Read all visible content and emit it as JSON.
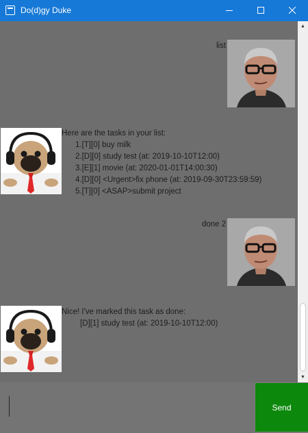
{
  "window": {
    "title": "Do(d)gy Duke",
    "controls": {
      "minimize": "minimize-icon",
      "maximize": "maximize-icon",
      "close": "close-icon"
    }
  },
  "chat": {
    "messages": [
      {
        "sender": "user",
        "text": "list"
      },
      {
        "sender": "duke",
        "lines": [
          "Here are the tasks in your list:",
          "1.[T][0] buy milk",
          "2.[D][0] study test (at: 2019-10-10T12:00)",
          "3.[E][1] movie (at: 2020-01-01T14:00:30)",
          "4.[D][0] <Urgent>fix phone (at: 2019-09-30T23:59:59)",
          "5.[T][0] <ASAP>submit project"
        ]
      },
      {
        "sender": "user",
        "text": "done 2"
      },
      {
        "sender": "duke",
        "lines": [
          "Nice! I've marked this task as done:",
          "[D][1] study test (at: 2019-10-10T12:00)"
        ]
      }
    ]
  },
  "input": {
    "value": "",
    "placeholder": ""
  },
  "send_button": {
    "label": "Send"
  },
  "colors": {
    "titlebar": "#1779d7",
    "chat_bg": "#6e6e6e",
    "send": "#0c880c"
  }
}
